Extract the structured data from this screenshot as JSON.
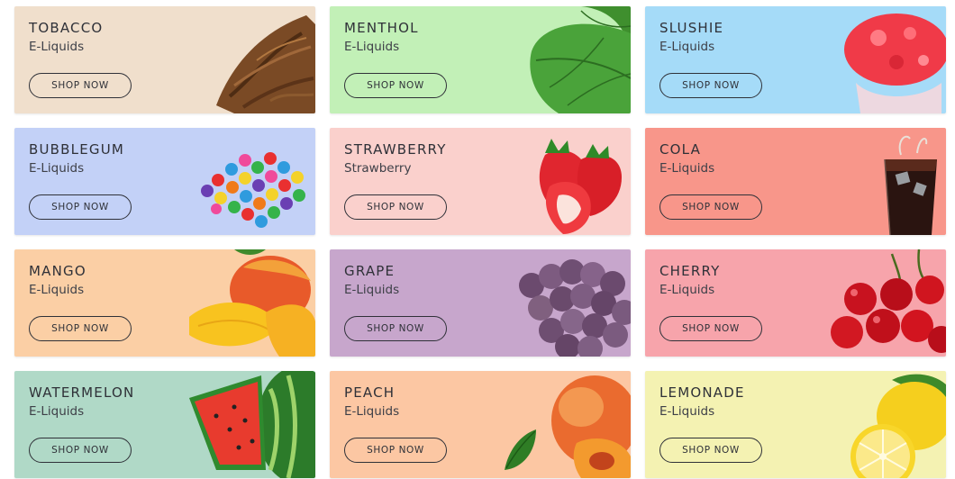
{
  "cards": [
    {
      "title": "TOBACCO",
      "subtitle": "E-Liquids",
      "button": "SHOP NOW",
      "bg": "#f0dfcc",
      "icon": "tobacco-leaves-icon"
    },
    {
      "title": "MENTHOL",
      "subtitle": "E-Liquids",
      "button": "SHOP NOW",
      "bg": "#c2f0b7",
      "icon": "mint-leaf-icon"
    },
    {
      "title": "SLUSHIE",
      "subtitle": "E-Liquids",
      "button": "SHOP NOW",
      "bg": "#a5dbf8",
      "icon": "slushie-cup-icon"
    },
    {
      "title": "BUBBLEGUM",
      "subtitle": "E-Liquids",
      "button": "SHOP NOW",
      "bg": "#c3d1f7",
      "icon": "gumballs-icon"
    },
    {
      "title": "STRAWBERRY",
      "subtitle": "Strawberry",
      "button": "SHOP NOW",
      "bg": "#fad0cc",
      "icon": "strawberries-icon"
    },
    {
      "title": "COLA",
      "subtitle": "E-Liquids",
      "button": "SHOP NOW",
      "bg": "#f8968a",
      "icon": "cola-glass-icon"
    },
    {
      "title": "MANGO",
      "subtitle": "E-Liquids",
      "button": "SHOP NOW",
      "bg": "#fbcfa5",
      "icon": "mango-icon"
    },
    {
      "title": "GRAPE",
      "subtitle": "E-Liquids",
      "button": "SHOP NOW",
      "bg": "#c7a6cc",
      "icon": "grapes-icon"
    },
    {
      "title": "CHERRY",
      "subtitle": "E-Liquids",
      "button": "SHOP NOW",
      "bg": "#f7a4ab",
      "icon": "cherries-icon"
    },
    {
      "title": "WATERMELON",
      "subtitle": "E-Liquids",
      "button": "SHOP NOW",
      "bg": "#b0d9c7",
      "icon": "watermelon-icon"
    },
    {
      "title": "PEACH",
      "subtitle": "E-Liquids",
      "button": "SHOP NOW",
      "bg": "#fcc7a3",
      "icon": "peach-icon"
    },
    {
      "title": "LEMONADE",
      "subtitle": "E-Liquids",
      "button": "SHOP NOW",
      "bg": "#f4f2b2",
      "icon": "lemon-icon"
    }
  ]
}
